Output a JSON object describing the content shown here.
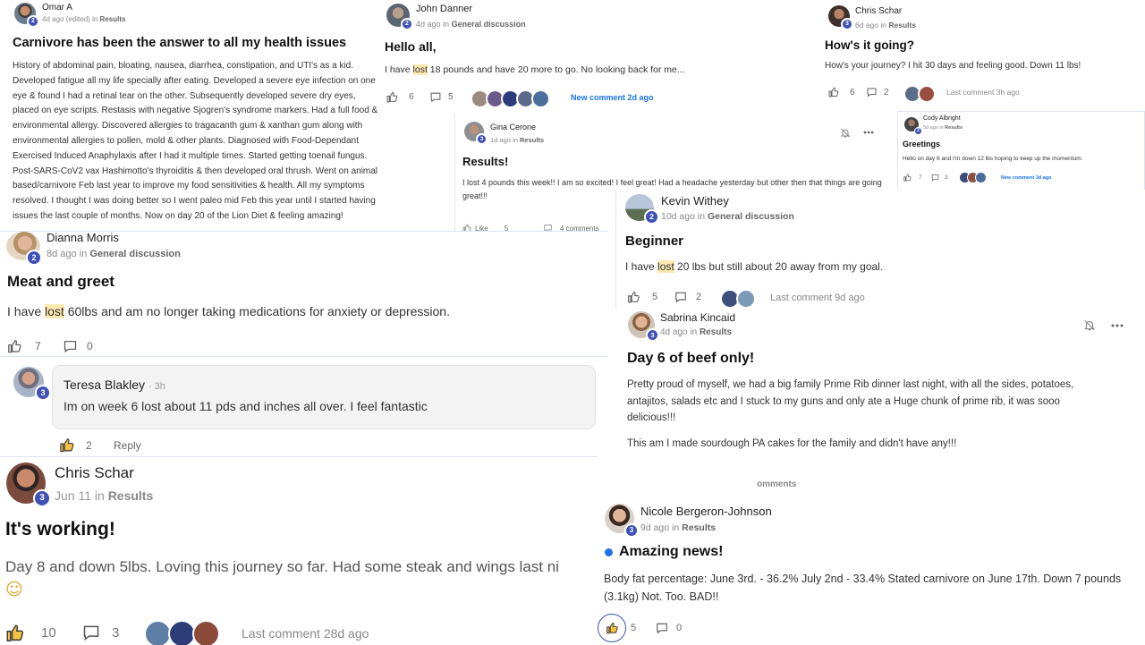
{
  "common": {
    "in": "in",
    "reply": "Reply",
    "like": "Like"
  },
  "p1": {
    "author": "Omar A",
    "badge": "2",
    "time": "4d ago (edited)",
    "group": "Results",
    "title": "Carnivore has been the answer to all my health issues",
    "body": "History of abdominal pain, bloating, nausea, diarrhea, constipation, and UTI's as a kid. Developed fatigue all my life specially after eating. Developed a severe eye infection on one eye & found I had a retinal tear on the other. Subsequently developed severe dry eyes, placed on eye scripts. Restasis with negative Sjogren's syndrome markers. Had a full food & environmental allergy. Discovered allergies to tragacanth gum & xanthan gum along with environmental allergies to pollen, mold & other plants. Diagnosed with Food-Dependant Exercised Induced Anaphylaxis after I had it multiple times. Started getting toenail fungus. Post-SARS-CoV2 vax Hashimotto's thyroiditis & then developed oral thrush. Went on animal based/carnivore Feb last year to improve my food sensitivities & health. All my symptoms resolved. I thought I was doing better so I went paleo mid Feb this year until I started having issues the last couple of months. Now on day 20 of the Lion Diet & feeling amazing!"
  },
  "p2": {
    "author": "John Danner",
    "badge": "2",
    "time": "4d ago",
    "group": "General discussion",
    "title": "Hello all,",
    "body_pre": "I have ",
    "body_hl": "lost",
    "body_post": " 18 pounds and have 20 more to go. No looking back for me...",
    "likes": "6",
    "comments": "5",
    "new_comment": "New comment 2d ago"
  },
  "p3": {
    "author": "Chris Schar",
    "badge": "3",
    "time": "6d ago",
    "group": "Results",
    "title": "How's it going?",
    "body": "How's your journey? I hit 30 days and feeling good. Down 11 lbs!",
    "likes": "6",
    "comments": "2",
    "last_comment": "Last comment 3h ago"
  },
  "p4": {
    "author": "Gina Cerone",
    "badge": "3",
    "time": "1d ago",
    "group": "Results",
    "title": "Results!",
    "body": "I lost 4 pounds this week!! I am so excited! I feel great! Had a headache yesterday but other then that things are going great!!!",
    "like_label": "Like",
    "likes": "5",
    "comments": "4 comments"
  },
  "p5": {
    "author": "Cody Albright",
    "badge": "2",
    "time": "5d ago",
    "group": "Results",
    "title": "Greetings",
    "body": "Hello on day 6 and I'm down 12 lbs hoping to keep up the momentum.",
    "likes": "7",
    "comments": "3",
    "new_comment": "New comment 3d ago"
  },
  "p6": {
    "author": "Dianna Morris",
    "badge": "2",
    "time": "8d ago",
    "group": "General discussion",
    "title": "Meat and greet",
    "body_pre": "I have ",
    "body_hl": "lost",
    "body_post": " 60lbs and am no longer taking medications for anxiety or depression.",
    "likes": "7",
    "comments": "0"
  },
  "p6_reply": {
    "author": "Teresa Blakley",
    "badge": "3",
    "time": "3h",
    "body": "Im on week 6 lost about 11 pds and inches all over. I feel fantastic",
    "likes": "2"
  },
  "p7": {
    "author": "Kevin Withey",
    "badge": "2",
    "time": "10d ago",
    "group": "General discussion",
    "title": "Beginner",
    "body_pre": "I have ",
    "body_hl": "lost",
    "body_post": " 20 lbs but still about 20 away from my goal.",
    "likes": "5",
    "comments": "2",
    "last_comment": "Last comment 9d ago"
  },
  "p8": {
    "author": "Sabrina Kincaid",
    "badge": "3",
    "time": "4d ago",
    "group": "Results",
    "title": "Day 6 of beef only!",
    "body1": "Pretty proud of myself, we had a big family Prime Rib dinner last night, with all the sides, potatoes, antajitos, salads etc and I stuck to my guns and only ate a Huge chunk of prime rib, it was sooo delicious!!!",
    "body2": "This am I made sourdough PA cakes for the family and didn't have any!!!",
    "comments_label": "omments"
  },
  "p9": {
    "author": "Chris Schar",
    "badge": "3",
    "time": "Jun 11",
    "group": "Results",
    "title": "It's working!",
    "body": "Day 8 and down 5lbs. Loving this journey so far. Had some steak and wings last ni",
    "emoji": "☺",
    "likes": "10",
    "comments": "3",
    "last_comment": "Last comment 28d ago"
  },
  "p10": {
    "author": "Nicole Bergeron-Johnson",
    "badge": "3",
    "time": "9d ago",
    "group": "Results",
    "title": "Amazing news!",
    "body": "Body fat percentage: June 3rd. - 36.2% July 2nd - 33.4% Stated carnivore on June 17th. Down 7 pounds (3.1kg) Not. Too. BAD!!",
    "likes": "5",
    "comments": "0"
  },
  "colors": {
    "accent": "#1a73e8",
    "badge": "#3f51b5",
    "highlight": "#fde8b0"
  }
}
